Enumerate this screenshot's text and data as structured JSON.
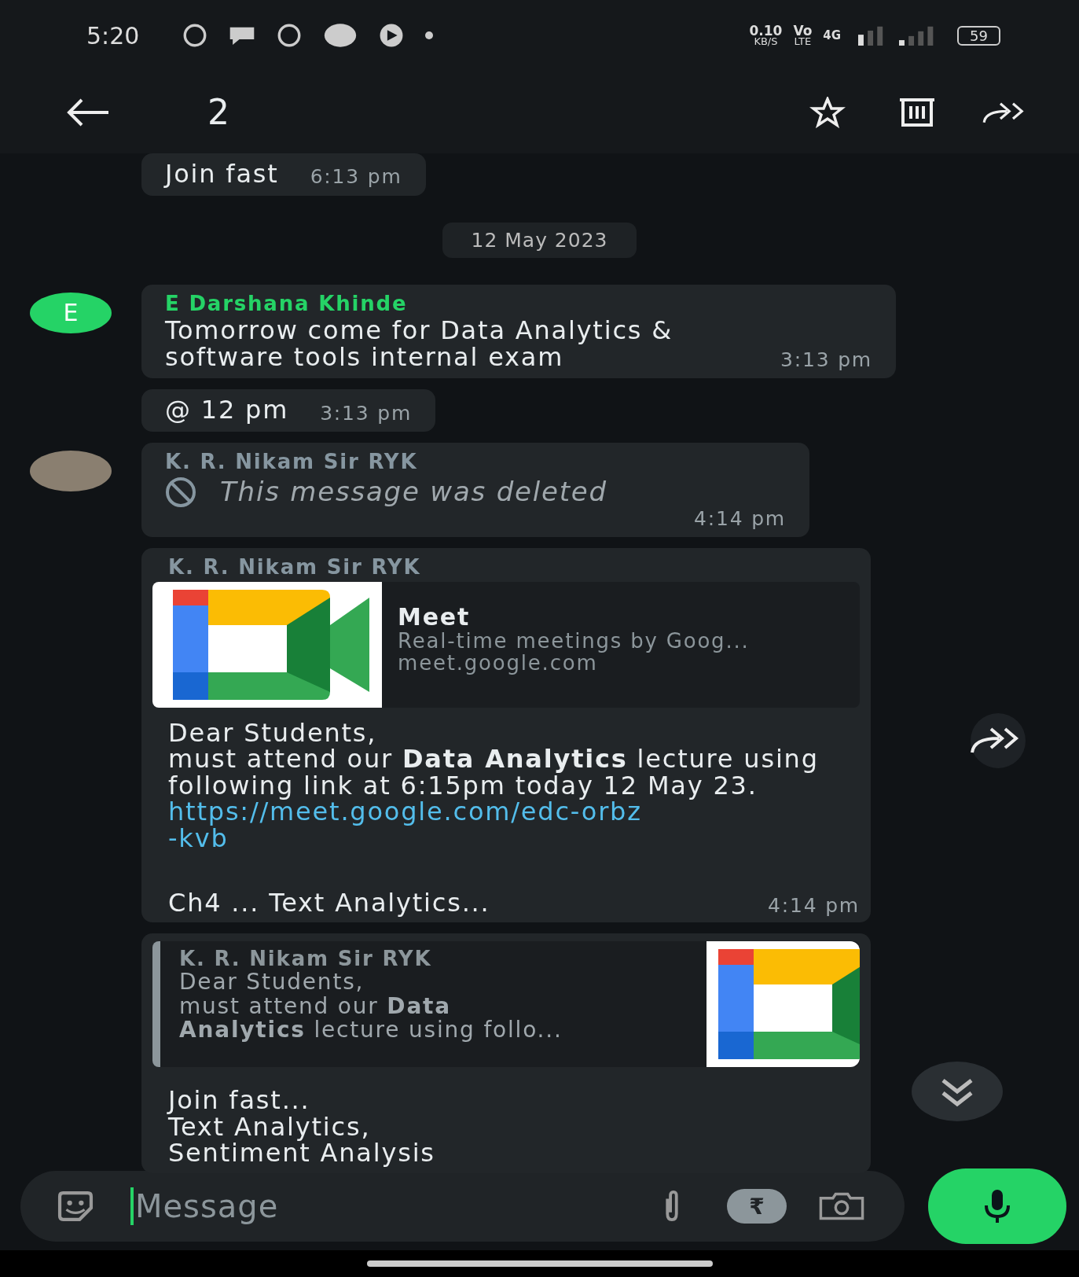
{
  "status_bar": {
    "time": "5:20",
    "speed": "0.10",
    "speed_unit": "KB/S",
    "volte": "Vo",
    "volte_sub": "LTE",
    "network": "4G",
    "battery": "59"
  },
  "toolbar": {
    "count": "2"
  },
  "messages": [
    {
      "kind": "text",
      "text": "Join fast",
      "time": "6:13 pm"
    },
    {
      "kind": "date",
      "text": "12 May 2023"
    },
    {
      "kind": "text",
      "avatar": {
        "kind": "letter",
        "letter": "E"
      },
      "sender": "E Darshana Khinde",
      "color": "#25d366",
      "text": "Tomorrow come for Data Analytics & software tools internal exam",
      "time": "3:13 pm"
    },
    {
      "kind": "text",
      "text": "@ 12 pm",
      "time": "3:13 pm"
    },
    {
      "kind": "deleted",
      "avatar": {
        "kind": "photo"
      },
      "sender": "K. R. Nikam Sir RYK",
      "color": "#8696a0",
      "text": "This message was deleted",
      "time": "4:14 pm"
    },
    {
      "kind": "link",
      "sender": "K. R. Nikam Sir RYK",
      "color": "#8696a0",
      "preview": {
        "title": "Meet",
        "description": "Real-time meetings by Goog...",
        "domain": "meet.google.com"
      },
      "body": "Dear Students,\n must attend our **Data Analytics** lecture using following link at 6:15pm today 12 May 23.",
      "link": "https://meet.google.com/edc-orbz\n-kvb",
      "footer": "Ch4 ... Text Analytics...",
      "time": "4:14 pm"
    },
    {
      "kind": "quote",
      "quote": {
        "sender": "K. R. Nikam Sir RYK",
        "text": "Dear Students,\n must attend our **Data\nAnalytics** lecture using follo..."
      },
      "text": "Join fast...\nText Analytics,\nSentiment Analysis"
    }
  ],
  "input": {
    "placeholder": "Message",
    "rupee": "₹"
  }
}
